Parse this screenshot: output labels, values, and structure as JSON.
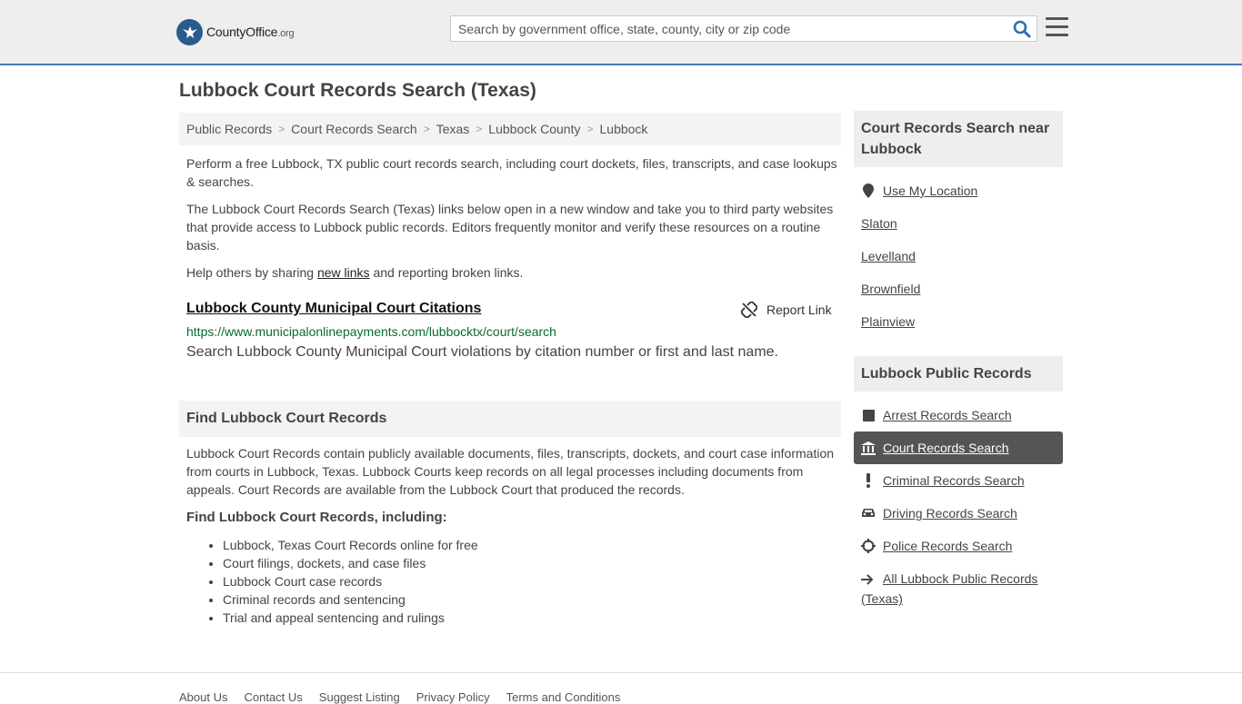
{
  "header": {
    "logo_text": "CountyOffice",
    "logo_suffix": ".org",
    "search_placeholder": "Search by government office, state, county, city or zip code"
  },
  "page": {
    "title": "Lubbock Court Records Search (Texas)",
    "breadcrumb": [
      "Public Records",
      "Court Records Search",
      "Texas",
      "Lubbock County",
      "Lubbock"
    ],
    "intro1": "Perform a free Lubbock, TX public court records search, including court dockets, files, transcripts, and case lookups & searches.",
    "intro2": "The Lubbock Court Records Search (Texas) links below open in a new window and take you to third party websites that provide access to Lubbock public records. Editors frequently monitor and verify these resources on a routine basis.",
    "help_prefix": "Help others by sharing ",
    "help_link": "new links",
    "help_suffix": " and reporting broken links."
  },
  "result": {
    "title": "Lubbock County Municipal Court Citations",
    "report_label": "Report Link",
    "url": "https://www.municipalonlinepayments.com/lubbocktx/court/search",
    "description": "Search Lubbock County Municipal Court violations by citation number or first and last name."
  },
  "find_section": {
    "heading": "Find Lubbock Court Records",
    "body": "Lubbock Court Records contain publicly available documents, files, transcripts, dockets, and court case information from courts in Lubbock, Texas. Lubbock Courts keep records on all legal processes including documents from appeals. Court Records are available from the Lubbock Court that produced the records.",
    "subheading": "Find Lubbock Court Records, including:",
    "bullets": [
      "Lubbock, Texas Court Records online for free",
      "Court filings, dockets, and case files",
      "Lubbock Court case records",
      "Criminal records and sentencing",
      "Trial and appeal sentencing and rulings"
    ]
  },
  "sidebar": {
    "near_heading": "Court Records Search near Lubbock",
    "use_location": "Use My Location",
    "near_links": [
      "Slaton",
      "Levelland",
      "Brownfield",
      "Plainview"
    ],
    "public_heading": "Lubbock Public Records",
    "public_links": [
      {
        "label": "Arrest Records Search",
        "icon": "square-icon"
      },
      {
        "label": "Court Records Search",
        "icon": "courthouse-icon",
        "active": true
      },
      {
        "label": "Criminal Records Search",
        "icon": "exclamation-icon"
      },
      {
        "label": "Driving Records Search",
        "icon": "car-icon"
      },
      {
        "label": "Police Records Search",
        "icon": "crosshair-icon"
      }
    ],
    "all_link": "All Lubbock Public Records (Texas)"
  },
  "footer": {
    "links": [
      "About Us",
      "Contact Us",
      "Suggest Listing",
      "Privacy Policy",
      "Terms and Conditions"
    ]
  },
  "colors": {
    "accent_border": "#4a7ab5",
    "active_bg": "#555555",
    "url_green": "#0a6b2e"
  }
}
